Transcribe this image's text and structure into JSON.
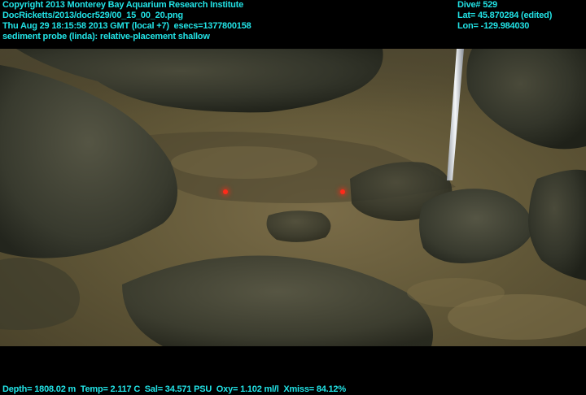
{
  "overlay": {
    "top_left": [
      "Copyright 2013 Monterey Bay Aquarium Research Institute",
      "DocRicketts/2013/docr529/00_15_00_20.png",
      "Thu Aug 29 18:15:58 2013 GMT (local +7)  esecs=1377800158",
      "sediment probe (linda): relative-placement shallow"
    ],
    "top_right": [
      "Dive# 529",
      "Lat= 45.870284 (edited)",
      "Lon= -129.984030"
    ],
    "bottom": "Depth= 1808.02 m  Temp= 2.117 C  Sal= 34.571 PSU  Oxy= 1.102 ml/l  Xmiss= 84.12%"
  },
  "colors": {
    "overlay_text": "#22e3e6",
    "laser_dot": "#ff2a1a",
    "sediment": "#6f6342",
    "rock": "#2f3126"
  }
}
